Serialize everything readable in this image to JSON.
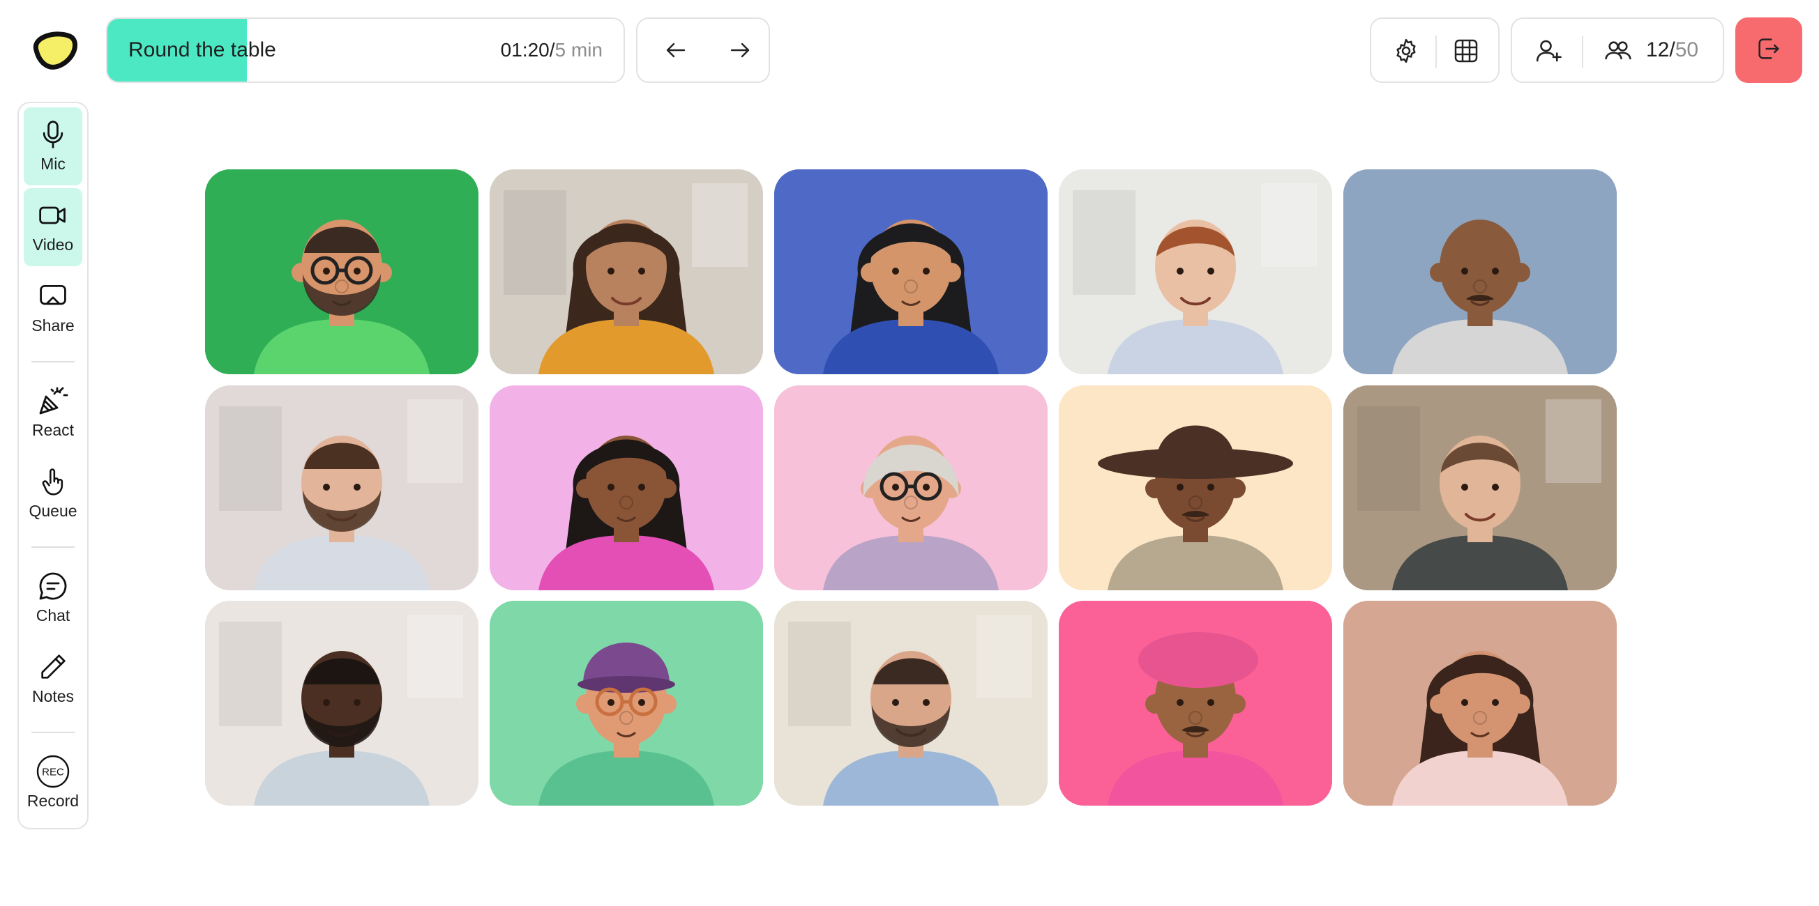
{
  "header": {
    "session_title": "Round the table",
    "elapsed": "01:20",
    "separator": "/",
    "total": "5 min",
    "progress": 0.27,
    "participants_current": "12",
    "participants_separator": "/",
    "participants_max": "50"
  },
  "sidebar": {
    "mic": "Mic",
    "video": "Video",
    "share": "Share",
    "react": "React",
    "queue": "Queue",
    "chat": "Chat",
    "notes": "Notes",
    "record": "Record",
    "record_badge": "REC"
  },
  "colors": {
    "accent": "#4be8c3",
    "active_item": "#ccf8ec",
    "exit": "#f76b6f",
    "logo": "#f4ef67"
  },
  "icons": [
    "logo",
    "arrow-left-icon",
    "arrow-right-icon",
    "gear-icon",
    "grid-icon",
    "add-user-icon",
    "users-icon",
    "exit-icon",
    "microphone-icon",
    "video-camera-icon",
    "screen-share-icon",
    "party-popper-icon",
    "raised-hand-icon",
    "chat-bubble-icon",
    "pencil-icon",
    "rec-icon"
  ],
  "participants": [
    {
      "kind": "avatar",
      "bg": "#2fae56",
      "skin": "#d8946a",
      "hair": "#3a2a22",
      "shirt": "#5bd46e",
      "accessory": "glasses-beard"
    },
    {
      "kind": "photo",
      "bg": "#cfc8bd",
      "skin": "#b9825e",
      "hair": "#3b271c",
      "shirt": "#e39a2d",
      "accessory": "curly"
    },
    {
      "kind": "avatar",
      "bg": "#4e6ac6",
      "skin": "#d4956b",
      "hair": "#1c1b1d",
      "shirt": "#2f4fb2",
      "accessory": "long-hair"
    },
    {
      "kind": "photo",
      "bg": "#e6e6e3",
      "skin": "#eac0a5",
      "hair": "#a3542f",
      "shirt": "#c9d3e3",
      "accessory": "short"
    },
    {
      "kind": "avatar",
      "bg": "#8ea5c1",
      "skin": "#8a5a3c",
      "hair": "#8a5a3c",
      "shirt": "#d6d6d6",
      "accessory": "mustache"
    },
    {
      "kind": "photo",
      "bg": "#dcd4d2",
      "skin": "#e2b59a",
      "hair": "#4a3122",
      "shirt": "#d6dbe4",
      "accessory": "beard"
    },
    {
      "kind": "avatar",
      "bg": "#f2b2e8",
      "skin": "#8a5537",
      "hair": "#1d1716",
      "shirt": "#e44fb6",
      "accessory": "curly"
    },
    {
      "kind": "avatar",
      "bg": "#f6c1d9",
      "skin": "#e5a78a",
      "hair": "#d9d6d0",
      "shirt": "#b9a3c7",
      "accessory": "glasses-grey"
    },
    {
      "kind": "avatar",
      "bg": "#fde6c5",
      "skin": "#7a4b31",
      "hair": "#4b3026",
      "shirt": "#b6a98f",
      "accessory": "hat"
    },
    {
      "kind": "photo",
      "bg": "#a08a72",
      "skin": "#e1b597",
      "hair": "#6a4a34",
      "shirt": "#464a48",
      "accessory": "short"
    },
    {
      "kind": "photo",
      "bg": "#e7e2dd",
      "skin": "#4a2f22",
      "hair": "#1c1512",
      "shirt": "#c9d3dc",
      "accessory": "beard"
    },
    {
      "kind": "avatar",
      "bg": "#7fd8a8",
      "skin": "#e09a74",
      "hair": "#1b1b1b",
      "shirt": "#59c08f",
      "accessory": "cap"
    },
    {
      "kind": "photo",
      "bg": "#e6ded1",
      "skin": "#d9a68a",
      "hair": "#3a2a22",
      "shirt": "#9db7d8",
      "accessory": "beard"
    },
    {
      "kind": "avatar",
      "bg": "#fb6197",
      "skin": "#9a6440",
      "hair": "#e8548f",
      "shirt": "#f2549d",
      "accessory": "beret"
    },
    {
      "kind": "avatar",
      "bg": "#d5a792",
      "skin": "#d49472",
      "hair": "#3a241b",
      "shirt": "#f2d2cf",
      "accessory": "long-hair"
    }
  ]
}
